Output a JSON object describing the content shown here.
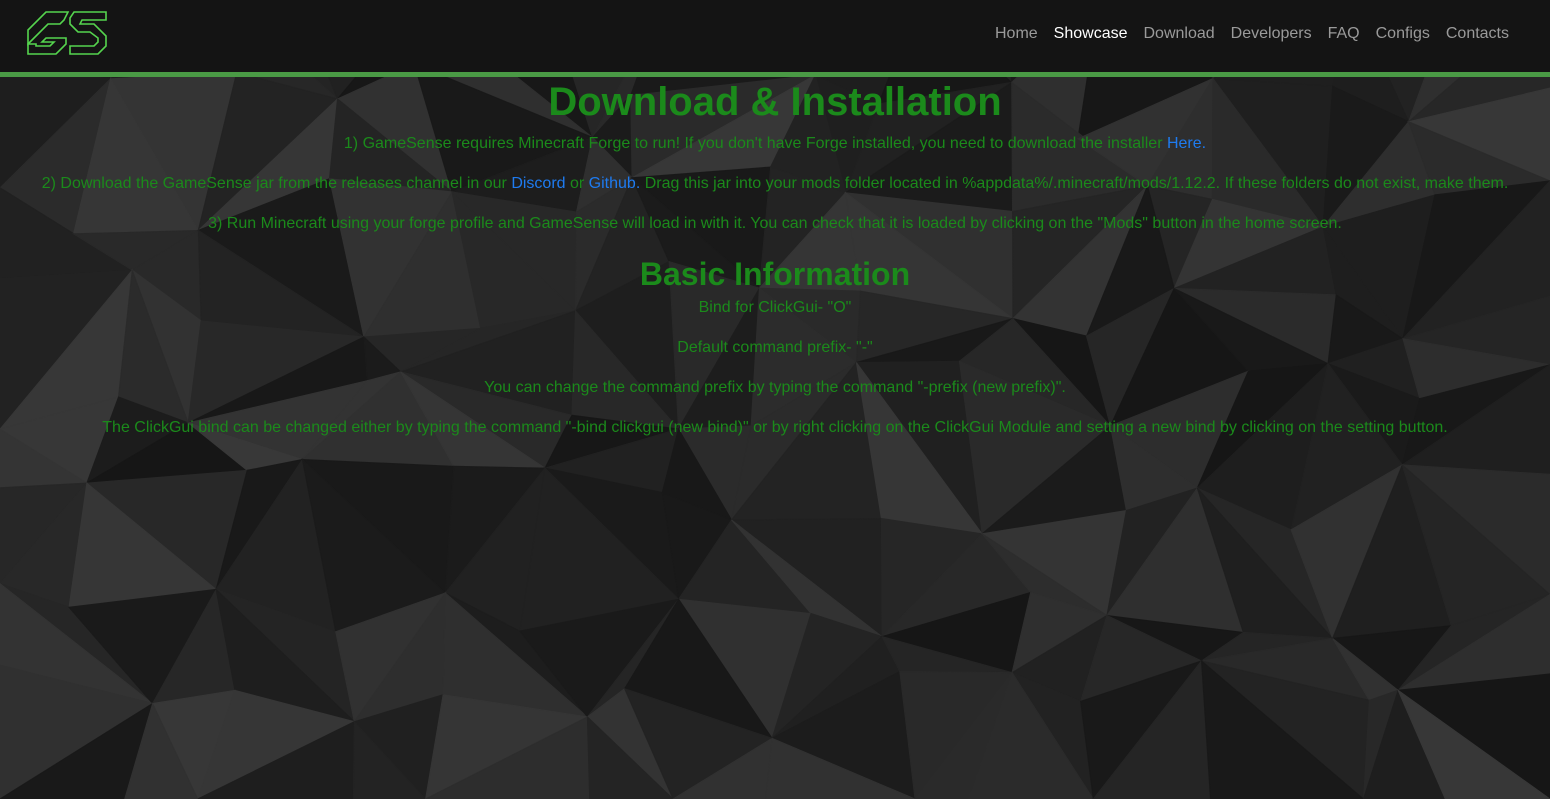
{
  "nav": {
    "logo_label": "GS",
    "items": [
      {
        "label": "Home"
      },
      {
        "label": "Showcase"
      },
      {
        "label": "Download"
      },
      {
        "label": "Developers"
      },
      {
        "label": "FAQ"
      },
      {
        "label": "Configs"
      },
      {
        "label": "Contacts"
      }
    ],
    "active_item": "Showcase"
  },
  "install": {
    "title": "Download & Installation",
    "step1_text": "1) GameSense requires Minecraft Forge to run! If you don't have Forge installed, you need to download the installer ",
    "step1_link": "Here.",
    "step2_prefix": "2) Download the GameSense jar from the releases channel in our ",
    "step2_link_discord": "Discord",
    "step2_or": " or ",
    "step2_link_github": "Github.",
    "step2_suffix": " Drag this jar into your mods folder located in %appdata%/.minecraft/mods/1.12.2. If these folders do not exist, make them.",
    "step3_text": "3) Run Minecraft using your forge profile and GameSense will load in with it. You can check that it is loaded by clicking on the \"Mods\" button in the home screen."
  },
  "basic": {
    "title": "Basic Information",
    "bind_text": "Bind for ClickGui- \"O\"",
    "prefix_text": "Default command prefix- \"-\"",
    "change_prefix_text": "You can change the command prefix by typing the command \"-prefix (new prefix)\".",
    "change_bind_text": "The ClickGui bind can be changed either by typing the command \"-bind clickgui (new bind)\" or by right clicking on the ClickGui Module and setting a new bind by clicking on the setting button."
  },
  "colors": {
    "accent_green": "#1b8a1b",
    "nav_border": "#4a9a45",
    "link_blue": "#1e7bf0",
    "navbar_bg": "#141414"
  }
}
